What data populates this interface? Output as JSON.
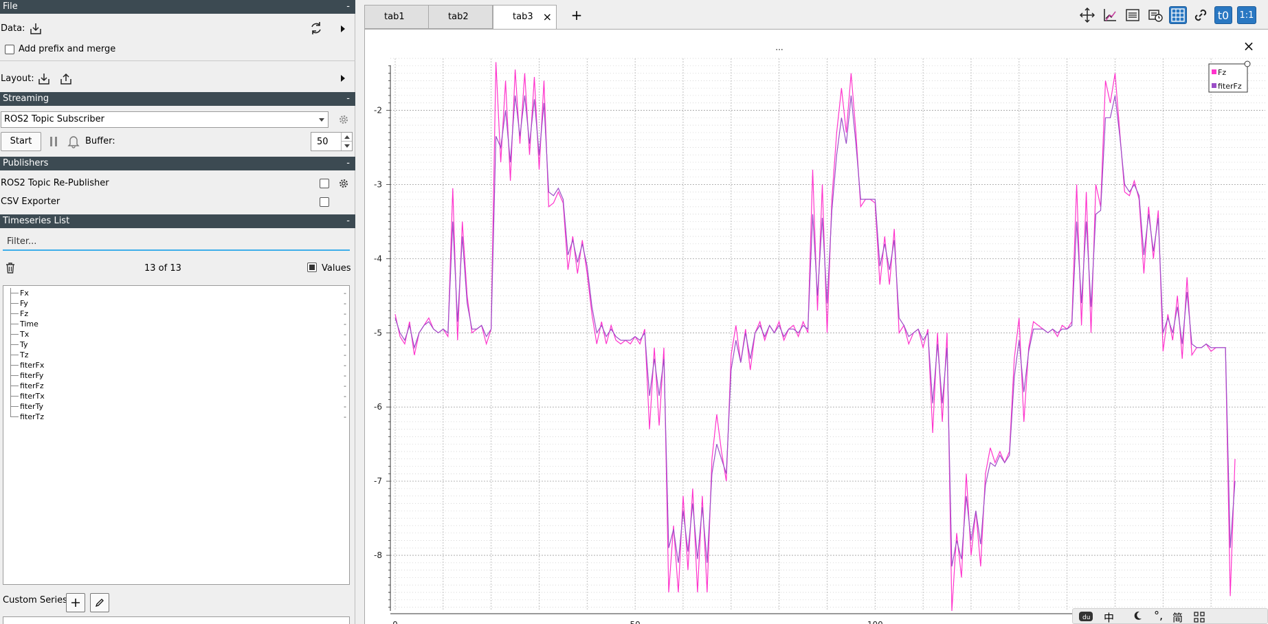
{
  "file_section": {
    "header": "File",
    "collapse": "-",
    "data_label": "Data:",
    "prefix_merge_label": "Add prefix and merge",
    "prefix_merge_checked": false,
    "layout_label": "Layout:"
  },
  "streaming_section": {
    "header": "Streaming",
    "collapse": "-",
    "plugin_selected": "ROS2 Topic Subscriber",
    "start_label": "Start",
    "buffer_label": "Buffer:",
    "buffer_value": "50"
  },
  "publishers_section": {
    "header": "Publishers",
    "collapse": "-",
    "items": [
      {
        "label": "ROS2 Topic Re-Publisher",
        "checked": false
      },
      {
        "label": "CSV Exporter",
        "checked": false
      }
    ]
  },
  "timeseries_section": {
    "header": "Timeseries List",
    "collapse": "-",
    "filter_placeholder": "Filter...",
    "count_text": "13 of 13",
    "values_label": "Values",
    "values_checked": true,
    "items": [
      "Fx",
      "Fy",
      "Fz",
      "Time",
      "Tx",
      "Ty",
      "Tz",
      "fiterFx",
      "fiterFy",
      "fiterFz",
      "fiterTx",
      "fiterTy",
      "fiterTz"
    ],
    "item_value": "-",
    "custom_series_label": "Custom Series:"
  },
  "tabs": [
    {
      "label": "tab1",
      "active": false
    },
    {
      "label": "tab2",
      "active": false
    },
    {
      "label": "tab3",
      "active": true
    }
  ],
  "tab_close": "×",
  "add_tab": "+",
  "toolbar": {
    "icons": [
      "move-icon",
      "plot-layout-icon",
      "list-icon",
      "time-icon",
      "grid-icon",
      "link-icon",
      "t0-icon",
      "ratio-icon"
    ],
    "t0_label": "t0",
    "ratio_label": "1:1"
  },
  "plot": {
    "title": "...",
    "close": "×",
    "legend": [
      {
        "name": "Fz",
        "color": "#ff33cc"
      },
      {
        "name": "fiterFz",
        "color": "#9b4ec7"
      }
    ]
  },
  "tray": {
    "items": [
      "中",
      "简"
    ]
  },
  "chart_data": {
    "type": "line",
    "title": "...",
    "xlabel": "",
    "ylabel": "",
    "xlim": [
      -1,
      177
    ],
    "ylim": [
      -8.75,
      -1.3
    ],
    "yticks": [
      -2,
      -3,
      -4,
      -5,
      -6,
      -7,
      -8
    ],
    "xticks_visible": [
      "0",
      "50",
      "100"
    ],
    "grid": true,
    "legend_position": "top-right",
    "series": [
      {
        "name": "Fz",
        "color": "#ff33cc",
        "values": [
          -4.75,
          -5.05,
          -5.15,
          -4.85,
          -5.3,
          -5.0,
          -4.9,
          -4.8,
          -4.95,
          -5.0,
          -4.95,
          -5.05,
          -3.05,
          -5.1,
          -3.5,
          -4.5,
          -5.0,
          -4.95,
          -4.9,
          -5.15,
          -4.95,
          -1.35,
          -2.7,
          -1.6,
          -2.95,
          -1.45,
          -2.45,
          -1.5,
          -2.6,
          -1.55,
          -2.8,
          -1.6,
          -3.3,
          -3.25,
          -3.1,
          -3.25,
          -4.15,
          -3.7,
          -4.2,
          -3.75,
          -4.2,
          -4.75,
          -5.15,
          -4.85,
          -5.15,
          -4.9,
          -5.1,
          -5.15,
          -5.1,
          -5.15,
          -5.05,
          -5.15,
          -4.95,
          -6.3,
          -5.2,
          -6.25,
          -5.2,
          -8.5,
          -7.6,
          -8.5,
          -7.2,
          -8.2,
          -7.1,
          -8.5,
          -7.2,
          -8.5,
          -6.7,
          -6.1,
          -6.6,
          -7.0,
          -5.3,
          -4.9,
          -5.4,
          -4.95,
          -5.5,
          -5.0,
          -4.85,
          -5.1,
          -4.9,
          -5.0,
          -4.85,
          -5.1,
          -4.95,
          -4.9,
          -5.05,
          -4.85,
          -5.0,
          -2.8,
          -4.7,
          -3.0,
          -5.0,
          -3.2,
          -2.3,
          -1.7,
          -2.3,
          -1.5,
          -2.3,
          -3.3,
          -3.2,
          -3.2,
          -3.25,
          -4.35,
          -3.7,
          -4.35,
          -3.6,
          -5.0,
          -4.9,
          -5.15,
          -5.0,
          -4.95,
          -5.2,
          -4.95,
          -6.35,
          -5.0,
          -6.2,
          -5.0,
          -8.75,
          -7.7,
          -8.3,
          -6.9,
          -8.0,
          -7.4,
          -8.15,
          -6.9,
          -6.55,
          -6.75,
          -6.6,
          -6.75,
          -6.6,
          -5.35,
          -4.8,
          -6.2,
          -5.2,
          -4.85,
          -4.9,
          -4.95,
          -5.0,
          -4.95,
          -5.05,
          -4.9,
          -4.95,
          -4.85,
          -3.0,
          -4.9,
          -3.1,
          -5.0,
          -3.0,
          -3.3,
          -1.6,
          -1.9,
          -1.5,
          -2.3,
          -3.1,
          -3.15,
          -2.95,
          -3.2,
          -4.2,
          -3.3,
          -4.0,
          -3.35,
          -5.25,
          -4.75,
          -5.1,
          -4.5,
          -5.35,
          -4.25,
          -5.3,
          -5.2,
          -5.2,
          -5.15,
          -5.25,
          -5.2,
          -5.2,
          -5.2,
          -8.55,
          -6.7
        ]
      },
      {
        "name": "fiterFz",
        "color": "#9b4ec7",
        "values": [
          -4.8,
          -5.0,
          -5.1,
          -4.9,
          -5.2,
          -5.0,
          -4.9,
          -4.85,
          -4.95,
          -5.0,
          -4.95,
          -5.0,
          -3.5,
          -4.85,
          -3.7,
          -4.6,
          -4.95,
          -4.95,
          -4.9,
          -5.05,
          -4.95,
          -2.35,
          -2.5,
          -2.0,
          -2.7,
          -1.8,
          -2.35,
          -1.8,
          -2.45,
          -1.85,
          -2.6,
          -1.9,
          -3.1,
          -3.15,
          -3.05,
          -3.2,
          -3.95,
          -3.75,
          -4.05,
          -3.8,
          -4.1,
          -4.65,
          -5.0,
          -4.9,
          -5.05,
          -4.95,
          -5.05,
          -5.1,
          -5.1,
          -5.1,
          -5.05,
          -5.1,
          -5.0,
          -5.85,
          -5.35,
          -5.85,
          -5.35,
          -7.9,
          -7.65,
          -8.1,
          -7.4,
          -7.95,
          -7.3,
          -8.05,
          -7.35,
          -8.1,
          -6.9,
          -6.5,
          -6.7,
          -6.9,
          -5.5,
          -5.1,
          -5.4,
          -5.0,
          -5.35,
          -5.0,
          -4.9,
          -5.05,
          -4.9,
          -5.0,
          -4.9,
          -5.05,
          -4.95,
          -4.95,
          -5.0,
          -4.9,
          -4.95,
          -3.4,
          -4.5,
          -3.45,
          -4.6,
          -3.35,
          -2.6,
          -2.1,
          -2.45,
          -1.8,
          -2.45,
          -3.2,
          -3.2,
          -3.2,
          -3.2,
          -4.1,
          -3.8,
          -4.15,
          -3.75,
          -4.8,
          -4.9,
          -5.05,
          -5.0,
          -4.95,
          -5.1,
          -5.0,
          -5.95,
          -5.15,
          -5.95,
          -5.2,
          -8.15,
          -7.8,
          -8.05,
          -7.2,
          -7.8,
          -7.4,
          -7.85,
          -7.05,
          -6.75,
          -6.8,
          -6.65,
          -6.75,
          -6.65,
          -5.6,
          -5.1,
          -5.8,
          -5.25,
          -4.95,
          -4.95,
          -4.95,
          -5.0,
          -4.95,
          -5.0,
          -4.95,
          -4.95,
          -4.9,
          -3.5,
          -4.6,
          -3.5,
          -4.65,
          -3.4,
          -3.35,
          -2.1,
          -2.1,
          -1.8,
          -2.35,
          -3.0,
          -3.1,
          -3.0,
          -3.15,
          -3.95,
          -3.4,
          -3.9,
          -3.45,
          -5.0,
          -4.8,
          -5.0,
          -4.65,
          -5.15,
          -4.45,
          -5.15,
          -5.2,
          -5.2,
          -5.15,
          -5.2,
          -5.2,
          -5.2,
          -5.2,
          -7.9,
          -7.0
        ]
      }
    ]
  }
}
